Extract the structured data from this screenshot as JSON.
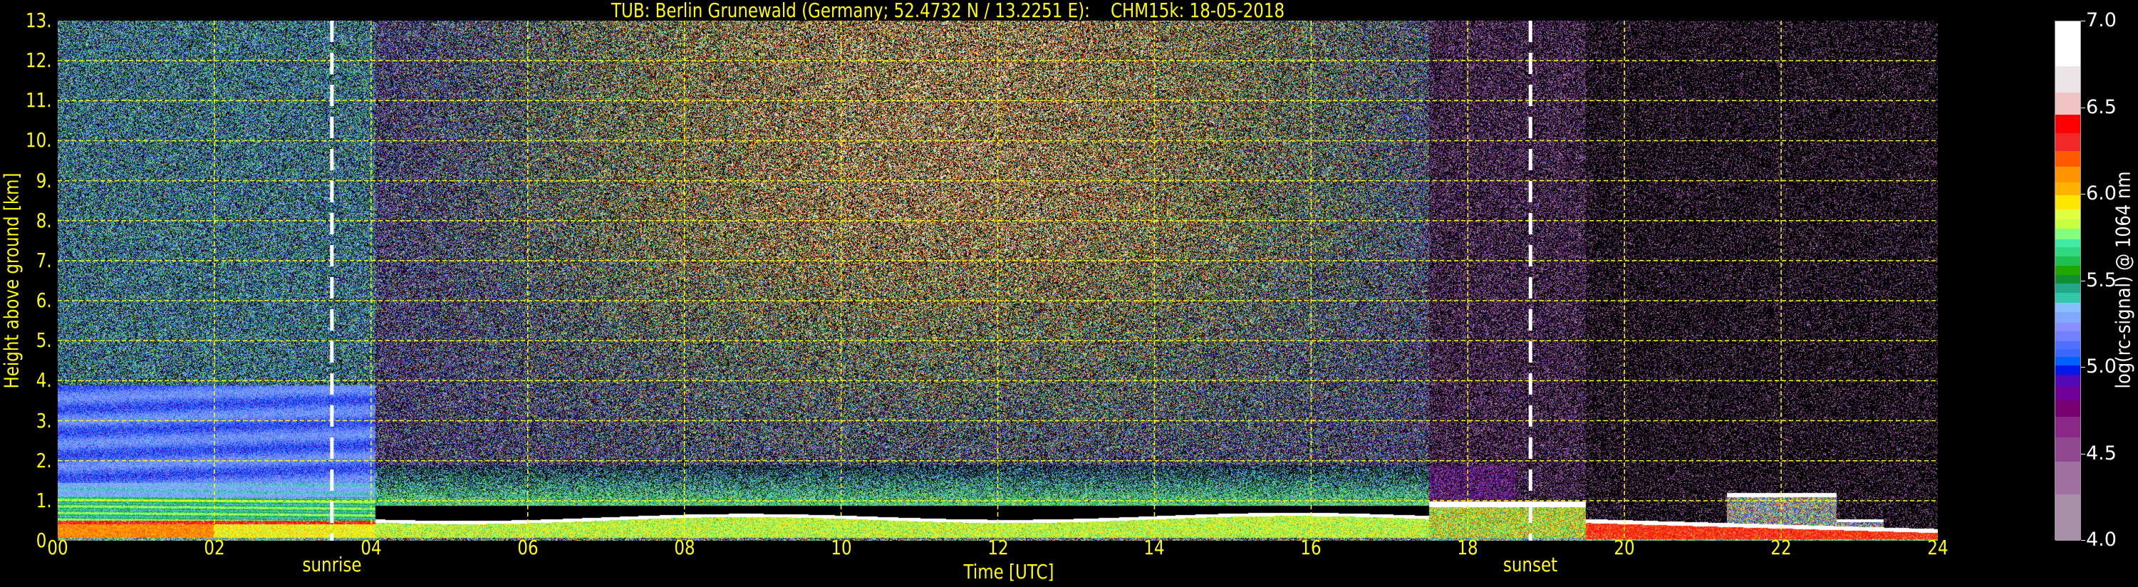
{
  "chart_data": {
    "type": "heatmap",
    "title": "TUB: Berlin Grunewald (Germany; 52.4732 N / 13.2251 E):    CHM15k: 18-05-2018",
    "xlabel": "Time [UTC]",
    "ylabel": "Height above ground [km]",
    "xlim": [
      0,
      24
    ],
    "ylim": [
      0,
      13
    ],
    "grid": true,
    "x_ticks": [
      {
        "value": 0,
        "label": "00"
      },
      {
        "value": 2,
        "label": "02"
      },
      {
        "value": 4,
        "label": "04"
      },
      {
        "value": 6,
        "label": "06"
      },
      {
        "value": 8,
        "label": "08"
      },
      {
        "value": 10,
        "label": "10"
      },
      {
        "value": 12,
        "label": "12"
      },
      {
        "value": 14,
        "label": "14"
      },
      {
        "value": 16,
        "label": "16"
      },
      {
        "value": 18,
        "label": "18"
      },
      {
        "value": 20,
        "label": "20"
      },
      {
        "value": 22,
        "label": "22"
      },
      {
        "value": 24,
        "label": "24"
      }
    ],
    "y_ticks": [
      {
        "value": 0,
        "label": "0."
      },
      {
        "value": 1,
        "label": "1."
      },
      {
        "value": 2,
        "label": "2."
      },
      {
        "value": 3,
        "label": "3."
      },
      {
        "value": 4,
        "label": "4."
      },
      {
        "value": 5,
        "label": "5."
      },
      {
        "value": 6,
        "label": "6."
      },
      {
        "value": 7,
        "label": "7."
      },
      {
        "value": 8,
        "label": "8."
      },
      {
        "value": 9,
        "label": "9."
      },
      {
        "value": 10,
        "label": "10."
      },
      {
        "value": 11,
        "label": "11."
      },
      {
        "value": 12,
        "label": "12."
      },
      {
        "value": 13,
        "label": "13."
      }
    ],
    "annotations": [
      {
        "label": "sunrise",
        "x": 3.5
      },
      {
        "label": "sunset",
        "x": 18.8
      }
    ],
    "colorbar": {
      "label": "log(rc-signal) @ 1064 nm",
      "range": [
        4.0,
        7.0
      ],
      "ticks": [
        {
          "value": 4.0,
          "label": "4.0"
        },
        {
          "value": 4.5,
          "label": "4.5"
        },
        {
          "value": 5.0,
          "label": "5.0"
        },
        {
          "value": 5.5,
          "label": "5.5"
        },
        {
          "value": 6.0,
          "label": "6.0"
        },
        {
          "value": 6.5,
          "label": "6.5"
        },
        {
          "value": 7.0,
          "label": "7.0"
        }
      ],
      "boundaries": [
        4.0,
        4.268,
        4.458,
        4.599,
        4.718,
        4.811,
        4.893,
        4.962,
        5.014,
        5.064,
        5.107,
        5.156,
        5.213,
        5.26,
        5.321,
        5.375,
        5.433,
        5.487,
        5.535,
        5.589,
        5.643,
        5.697,
        5.742,
        5.803,
        5.857,
        5.917,
        5.997,
        6.071,
        6.161,
        6.254,
        6.356,
        6.464,
        6.589,
        6.741,
        7.0
      ],
      "colors": [
        "#a890a8",
        "#a070a0",
        "#904890",
        "#8a2888",
        "#780070",
        "#700098",
        "#5008b8",
        "#0018e8",
        "#0060ff",
        "#3868ff",
        "#5070ff",
        "#7080ff",
        "#8890ff",
        "#80a8ff",
        "#88c0ff",
        "#30c8a8",
        "#20a888",
        "#109030",
        "#20a800",
        "#20c050",
        "#30d880",
        "#40eaa0",
        "#80ff80",
        "#c8ff40",
        "#e0ff40",
        "#ffe600",
        "#ffb000",
        "#ff9400",
        "#ff5a00",
        "#f02828",
        "#ff0000",
        "#f0c4c4",
        "#ece4e6",
        "#ffffff"
      ]
    },
    "colors": {
      "axis_text": "#ffff00",
      "grid": "#ffff00",
      "background": "#000000",
      "colorbar_text": "#ffffff",
      "marker_lines": "#ffffff"
    }
  }
}
